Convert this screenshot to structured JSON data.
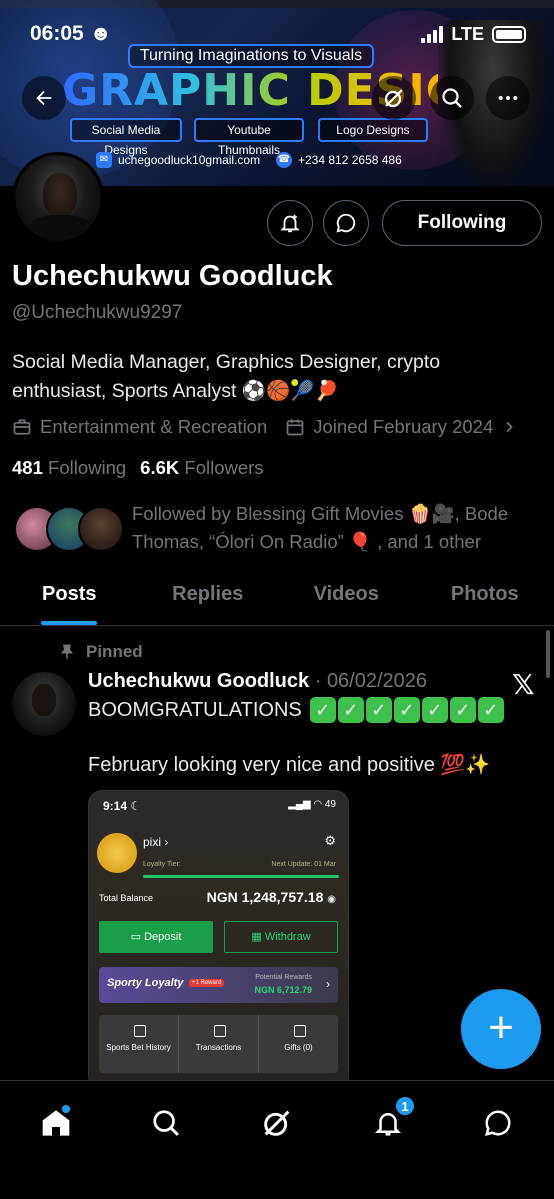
{
  "status_bar": {
    "time": "06:05",
    "network": "LTE"
  },
  "banner": {
    "tagline": "Turning Imaginations to Visuals",
    "headline": "GRAPHIC DESIGNER",
    "services": [
      "Social Media Designs",
      "Youtube Thumbnails",
      "Logo Designs"
    ],
    "email": "uchegoodluck10gmail.com",
    "phone": "+234 812 2658 486"
  },
  "header": {
    "back_icon": "back-arrow-icon",
    "grok_icon": "grok-icon",
    "search_icon": "search-icon",
    "more_icon": "more-icon"
  },
  "profile": {
    "name": "Uchechukwu Goodluck",
    "handle": "@Uchechukwu9297",
    "bio": "Social Media Manager, Graphics Designer, crypto enthusiast, Sports Analyst ⚽🏀🎾🏓",
    "category": "Entertainment & Recreation",
    "joined": "Joined February 2024",
    "following_count": "481",
    "following_label": "Following",
    "followers_count": "6.6K",
    "followers_label": "Followers",
    "followed_by": "Followed by Blessing Gift Movies 🍿🎥, Bode Thomas, “Ólori On Radio” 🎈 , and 1 other",
    "following_button": "Following"
  },
  "tabs": [
    {
      "label": "Posts",
      "active": true
    },
    {
      "label": "Replies",
      "active": false
    },
    {
      "label": "Videos",
      "active": false
    },
    {
      "label": "Photos",
      "active": false
    }
  ],
  "post": {
    "pinned_label": "Pinned",
    "author": "Uchechukwu Goodluck",
    "date": "06/02/2026",
    "line1": "BOOMGRATULATIONS",
    "checks": 7,
    "line2": "February looking very nice and positive 💯✨"
  },
  "embedded_screenshot": {
    "time": "9:14",
    "battery": "49",
    "username": "pixi",
    "loyalty_tier": "Loyalty Tier:",
    "next_update": "Next Update: 01 Mar",
    "total_balance_label": "Total Balance",
    "total_balance": "NGN  1,248,757.18",
    "deposit": "Deposit",
    "withdraw": "Withdraw",
    "loyalty_title": "Sporty Loyalty",
    "reward_badge": "+1 Reward",
    "potential_label": "Potential Rewards",
    "potential_value": "NGN 6,712.79",
    "grid": [
      "Sports Bet History",
      "Transactions",
      "Gifts (0)"
    ]
  },
  "fab": {
    "label": "+"
  },
  "bottom_nav": {
    "notification_badge": "1"
  },
  "colors": {
    "accent": "#1d9bf0",
    "muted": "#71767b",
    "background": "#000000",
    "check_green": "#3ec14a"
  }
}
